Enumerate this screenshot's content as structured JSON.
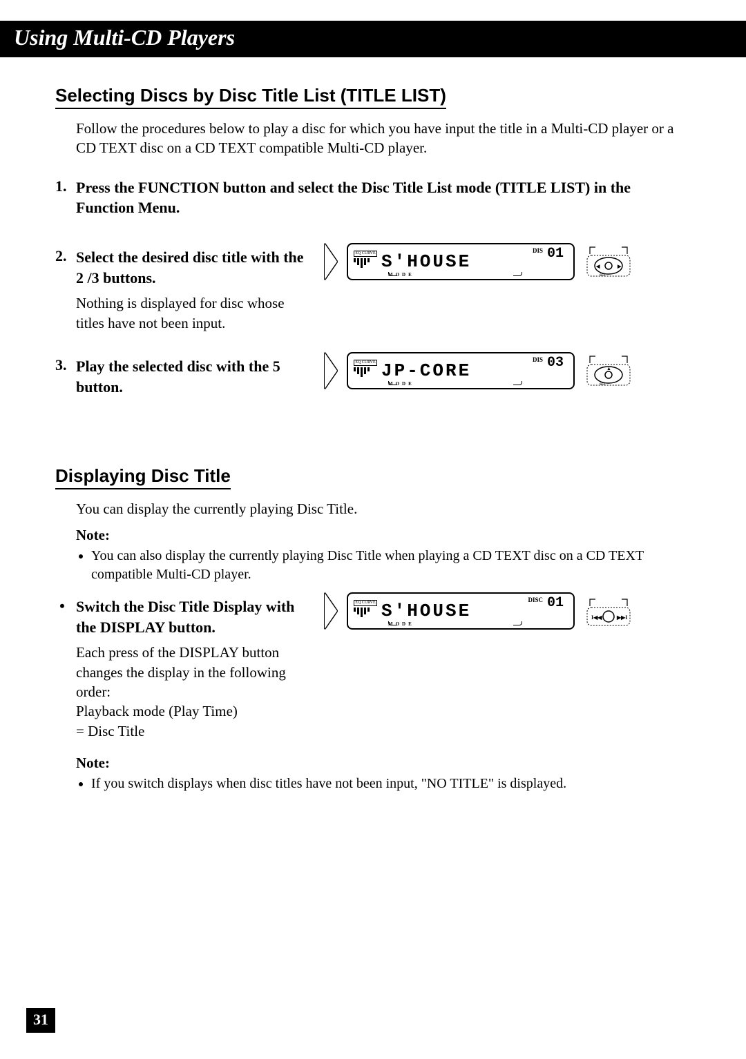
{
  "chapter_title": "Using Multi-CD Players",
  "page_number": "31",
  "section1": {
    "heading": "Selecting Discs by Disc Title List (TITLE LIST)",
    "intro": "Follow the procedures below to play a disc for which you have input the title in a Multi-CD player or a CD TEXT disc on a CD TEXT compatible Multi-CD player.",
    "steps": [
      {
        "num": "1.",
        "head": "Press the FUNCTION button and select the Disc Title List mode (TITLE LIST) in the Function Menu.",
        "sub": "",
        "display_text": "",
        "disc_num": ""
      },
      {
        "num": "2.",
        "head": "Select the desired disc title with the 2 /3  buttons.",
        "sub": "Nothing is displayed for disc whose titles have not been input.",
        "display_text": "S'HOUSE",
        "disc_num": "01",
        "disc_label": "DIS",
        "remote_label": "SEL"
      },
      {
        "num": "3.",
        "head": "Play the selected disc with the 5  button.",
        "sub": "",
        "display_text": "JP-CORE",
        "disc_num": "03",
        "disc_label": "DIS",
        "remote_label": "SEL"
      }
    ]
  },
  "section2": {
    "heading": "Displaying Disc Title",
    "intro": "You can display the currently playing Disc Title.",
    "note1_label": "Note:",
    "note1_items": [
      "You can also display the currently playing Disc Title when playing a CD TEXT disc on a CD TEXT compatible Multi-CD player."
    ],
    "bullet": {
      "head": "Switch the Disc Title Display with the DISPLAY button.",
      "sub_lines": [
        "Each press of the DISPLAY button changes the display in the following order:",
        "Playback mode (Play Time)",
        "=  Disc Title"
      ],
      "display_text": "S'HOUSE",
      "disc_num": "01",
      "disc_label": "DISC"
    },
    "note2_label": "Note:",
    "note2_items": [
      "If you switch displays when disc titles have not been input, \"NO TITLE\" is displayed."
    ]
  },
  "lcd_common": {
    "eq_label": "EQ CURVE",
    "mode_label": "MODE"
  }
}
